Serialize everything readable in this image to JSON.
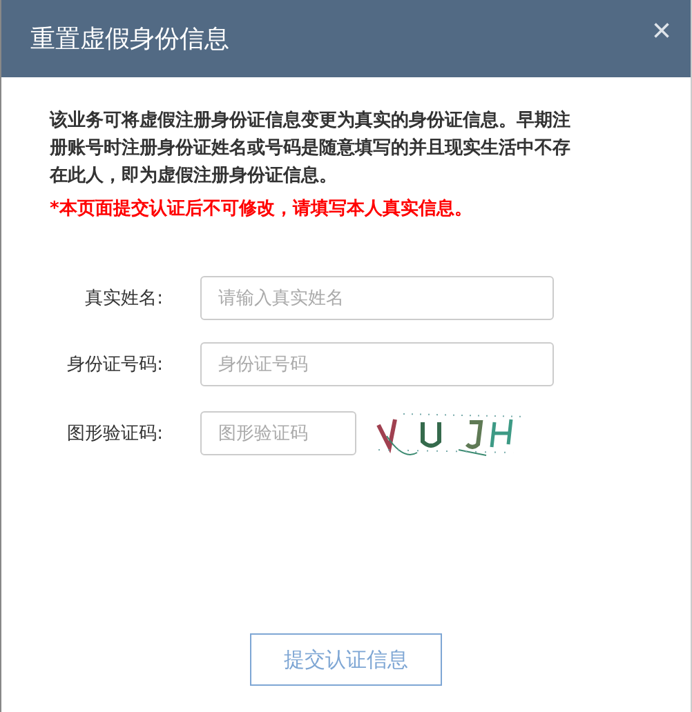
{
  "dialog": {
    "title": "重置虚假身份信息",
    "close": "×"
  },
  "intro": [
    "该业务可将虚假注册身份证信息变更为真实的身份证信息。早期注册账号时注册身份证姓名或号码是随意填写的并且现实生活中不存在此人，即为虚假注册身份证信息。"
  ],
  "warning": "*本页面提交认证后不可修改，请填写本人真实信息。",
  "fields": [
    {
      "label": "真实姓名:",
      "placeholder": "请输入真实姓名",
      "kind": "text"
    },
    {
      "label": "身份证号码:",
      "placeholder": "身份证号码",
      "kind": "text"
    },
    {
      "label": "图形验证码:",
      "placeholder": "图形验证码",
      "kind": "captcha"
    }
  ],
  "submit": "提交认证信息"
}
